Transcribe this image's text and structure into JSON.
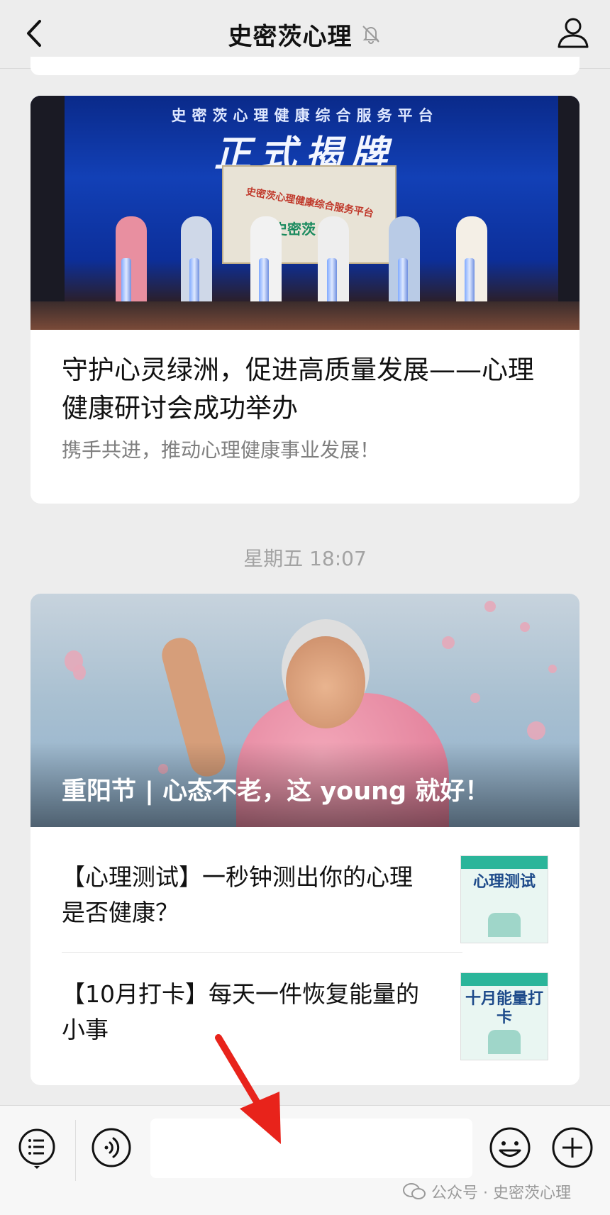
{
  "header": {
    "title": "史密茨心理"
  },
  "article1": {
    "banner_text": "史密茨心理健康综合服务平台",
    "callig_text": "正式揭牌",
    "board_text": "史密茨心理健康综合服务平台",
    "board_logo": "史密茨",
    "title": "守护心灵绿洲，促进高质量发展——心理健康研讨会成功举办",
    "subtitle": "携手共进，推动心理健康事业发展！"
  },
  "timestamp": "星期五 18:07",
  "article2": {
    "hero_title": "重阳节 | 心态不老，这 young 就好！",
    "items": [
      {
        "text": "【心理测试】一秒钟测出你的心理是否健康？",
        "thumb_text": "心理测试"
      },
      {
        "text": "【10月打卡】每天一件恢复能量的小事",
        "thumb_text": "十月能量打卡"
      }
    ]
  },
  "bottom_bar": {
    "input_value": ""
  },
  "watermark": "公众号 · 史密茨心理",
  "colors": {
    "background": "#ededed",
    "card": "#ffffff",
    "subtitle": "#7f7f7f",
    "accent_red": "#e8231b"
  }
}
